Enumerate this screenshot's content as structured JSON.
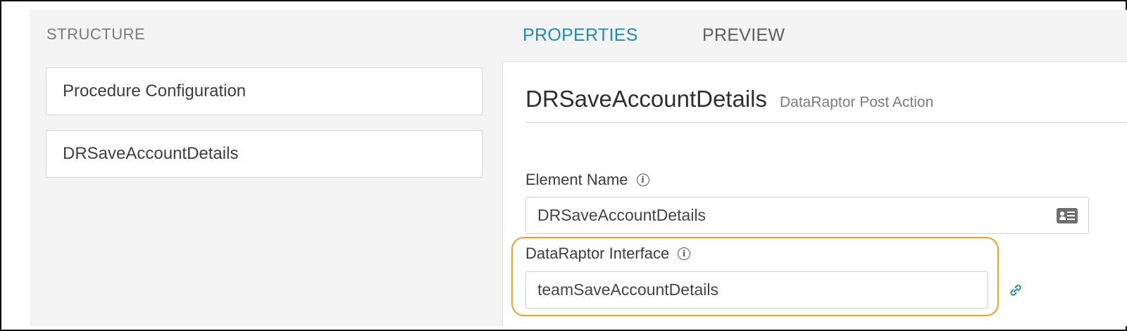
{
  "structure": {
    "title": "STRUCTURE",
    "items": [
      {
        "label": "Procedure Configuration"
      },
      {
        "label": "DRSaveAccountDetails"
      }
    ]
  },
  "tabs": [
    {
      "label": "PROPERTIES",
      "active": true
    },
    {
      "label": "PREVIEW",
      "active": false
    }
  ],
  "properties": {
    "title": "DRSaveAccountDetails",
    "subtitle": "DataRaptor Post Action",
    "element_name": {
      "label": "Element Name",
      "value": "DRSaveAccountDetails",
      "icon": "contact-card-icon"
    },
    "dataraptor_interface": {
      "label": "DataRaptor Interface",
      "value": "teamSaveAccountDetails",
      "icon": "link-icon"
    }
  },
  "colors": {
    "accent": "#1b8ac0",
    "highlight": "#f0a022"
  }
}
